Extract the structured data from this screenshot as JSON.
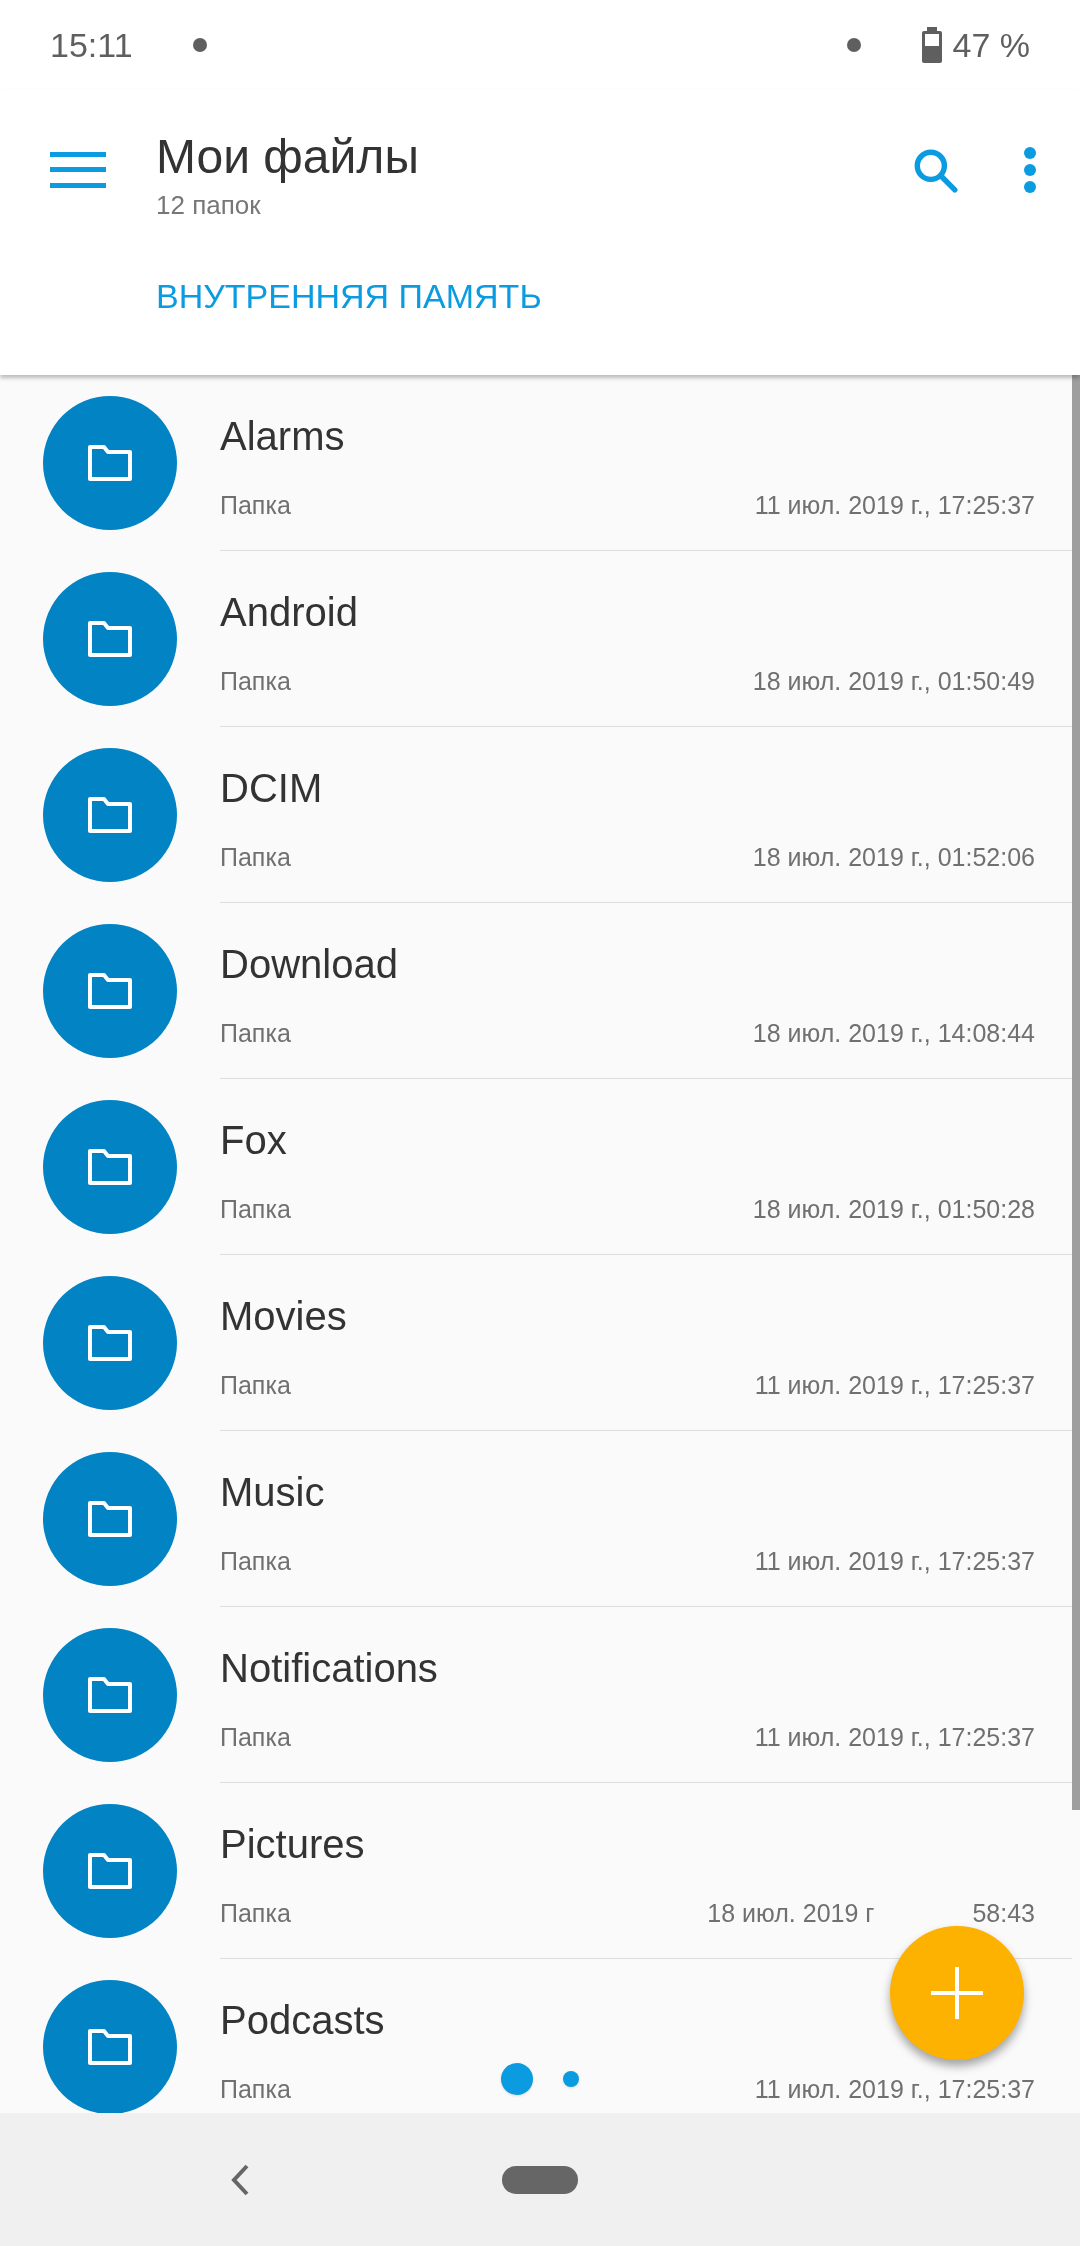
{
  "status_bar": {
    "time": "15:11",
    "battery": "47 %"
  },
  "app_bar": {
    "title": "Мои файлы",
    "subtitle": "12 папок"
  },
  "tabs": [
    {
      "label": "ВНУТРЕННЯЯ ПАМЯТЬ",
      "selected": true
    }
  ],
  "folders": [
    {
      "name": "Alarms",
      "type": "Папка",
      "modified": "11 июл. 2019 г., 17:25:37"
    },
    {
      "name": "Android",
      "type": "Папка",
      "modified": "18 июл. 2019 г., 01:50:49"
    },
    {
      "name": "DCIM",
      "type": "Папка",
      "modified": "18 июл. 2019 г., 01:52:06"
    },
    {
      "name": "Download",
      "type": "Папка",
      "modified": "18 июл. 2019 г., 14:08:44"
    },
    {
      "name": "Fox",
      "type": "Папка",
      "modified": "18 июл. 2019 г., 01:50:28"
    },
    {
      "name": "Movies",
      "type": "Папка",
      "modified": "11 июл. 2019 г., 17:25:37"
    },
    {
      "name": "Music",
      "type": "Папка",
      "modified": "11 июл. 2019 г., 17:25:37"
    },
    {
      "name": "Notifications",
      "type": "Папка",
      "modified": "11 июл. 2019 г., 17:25:37"
    },
    {
      "name": "Pictures",
      "type": "Папка",
      "modified": "18 июл. 2019 г",
      "modified_end": "58:43"
    },
    {
      "name": "Podcasts",
      "type": "Папка",
      "modified": "11 июл. 2019 г., 17:25:37"
    }
  ],
  "page_indicator": [
    {
      "selected": true
    },
    {
      "selected": false
    }
  ]
}
